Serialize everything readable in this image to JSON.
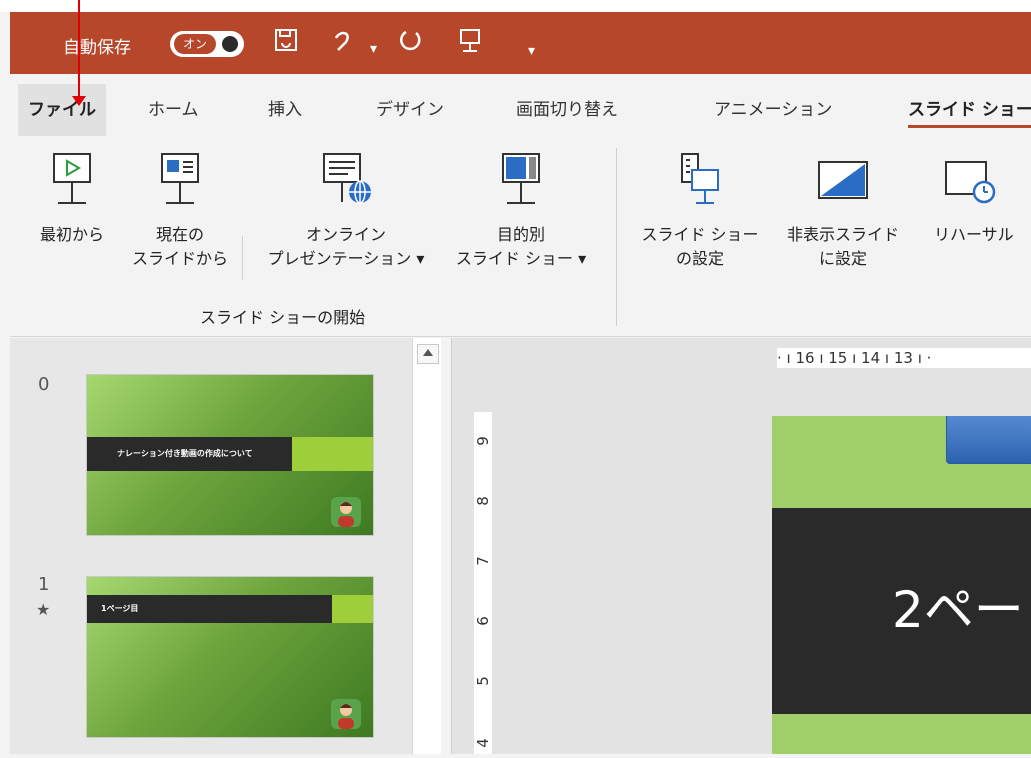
{
  "titlebar": {
    "autosave_label": "自動保存",
    "toggle_label": "オン"
  },
  "tabs": [
    {
      "label": "ファイル"
    },
    {
      "label": "ホーム"
    },
    {
      "label": "挿入"
    },
    {
      "label": "デザイン"
    },
    {
      "label": "画面切り替え"
    },
    {
      "label": "アニメーション"
    },
    {
      "label": "スライド ショー"
    }
  ],
  "ribbon": {
    "from_beginning": "最初から",
    "current_line1": "現在の",
    "current_line2": "スライドから",
    "online_line1": "オンライン",
    "online_line2": "プレゼンテーション ▾",
    "custom_line1": "目的別",
    "custom_line2": "スライド ショー ▾",
    "setup_line1": "スライド ショー",
    "setup_line2": "の設定",
    "hide_line1": "非表示スライド",
    "hide_line2": "に設定",
    "rehearse": "リハーサル",
    "group_start": "スライド ショーの開始"
  },
  "thumbnails": [
    {
      "number": "0",
      "title": "ナレーション付き動画の作成について",
      "star": ""
    },
    {
      "number": "1",
      "title": "1ページ目",
      "star": "★"
    }
  ],
  "editor": {
    "hruler": "· ı 16 ı 15 ı 14 ı 13 ı ·",
    "vruler": [
      "9",
      "8",
      "7",
      "6",
      "5",
      "4"
    ],
    "slide_title": "2ペー"
  },
  "colors": {
    "accent": "#b7472a",
    "pointer": "#e00000"
  }
}
